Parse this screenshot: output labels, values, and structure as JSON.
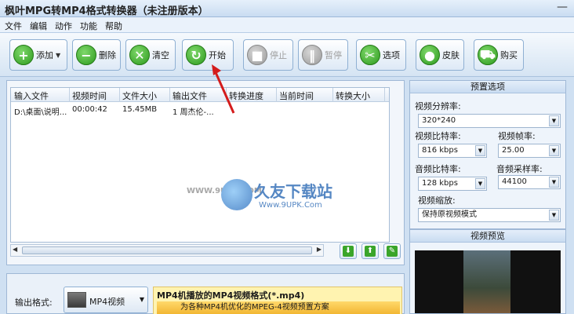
{
  "window": {
    "title": "枫叶MPG转MP4格式转换器（未注册版本）",
    "minimize": "—"
  },
  "menu": [
    "文件",
    "编辑",
    "动作",
    "功能",
    "帮助"
  ],
  "toolbar": {
    "add": "添加",
    "delete": "删除",
    "clear": "清空",
    "start": "开始",
    "stop": "停止",
    "pause": "暂停",
    "options": "选项",
    "skin": "皮肤",
    "buy": "购买"
  },
  "filelist": {
    "columns": [
      "输入文件",
      "视频时间",
      "文件大小",
      "输出文件",
      "转换进度",
      "当前时间",
      "转换大小"
    ],
    "rows": [
      [
        "D:\\桌面\\说明...",
        "00:00:42",
        "15.45MB",
        "1 周杰伦-...",
        "",
        "",
        ""
      ]
    ]
  },
  "watermark": {
    "site": "WWW.9UPK.COM",
    "brand": "久友下载站",
    "url": "Www.9UPK.Com"
  },
  "output": {
    "label": "输出格式:",
    "format": "MP4视频",
    "desc_title": "MP4机播放的MP4视频格式(*.mp4)",
    "desc_sub": "为各种MP4机优化的MPEG-4视频预置方案"
  },
  "presets": {
    "header": "预置选项",
    "resolution_label": "视频分辨率:",
    "resolution": "320*240",
    "vbitrate_label": "视频比特率:",
    "vbitrate": "816 kbps",
    "framerate_label": "视频帧率:",
    "framerate": "25.00",
    "abitrate_label": "音频比特率:",
    "abitrate": "128 kbps",
    "samplerate_label": "音频采样率:",
    "samplerate": "44100",
    "scale_label": "视频缩放:",
    "scale": "保持原视频模式"
  },
  "preview": {
    "header": "视频预览"
  },
  "colors": {
    "accent_green": "#2d9a1d",
    "annotation_red": "#d41c1c"
  }
}
